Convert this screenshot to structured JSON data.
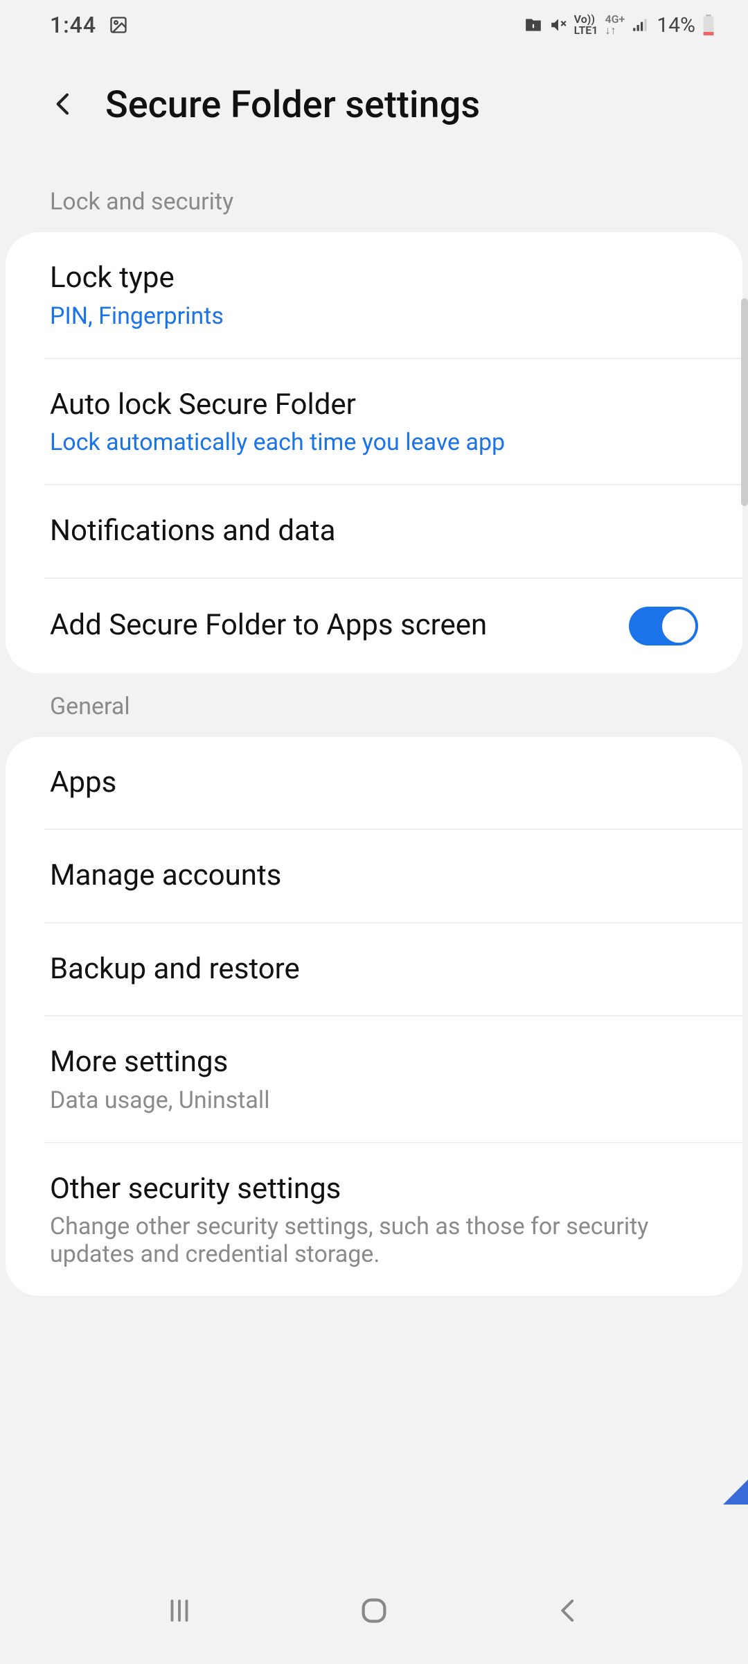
{
  "status": {
    "time": "1:44",
    "battery_percent": "14%"
  },
  "header": {
    "title": "Secure Folder settings"
  },
  "sections": {
    "lock_security": {
      "label": "Lock and security",
      "items": {
        "lock_type": {
          "title": "Lock type",
          "sub": "PIN, Fingerprints"
        },
        "auto_lock": {
          "title": "Auto lock Secure Folder",
          "sub": "Lock automatically each time you leave app"
        },
        "notifications": {
          "title": "Notifications and data"
        },
        "add_to_apps": {
          "title": "Add Secure Folder to Apps screen",
          "toggle": true
        }
      }
    },
    "general": {
      "label": "General",
      "items": {
        "apps": {
          "title": "Apps"
        },
        "manage_accounts": {
          "title": "Manage accounts"
        },
        "backup_restore": {
          "title": "Backup and restore"
        },
        "more_settings": {
          "title": "More settings",
          "sub": "Data usage, Uninstall"
        },
        "other_security": {
          "title": "Other security settings",
          "sub": "Change other security settings, such as those for security updates and credential storage."
        }
      }
    }
  }
}
